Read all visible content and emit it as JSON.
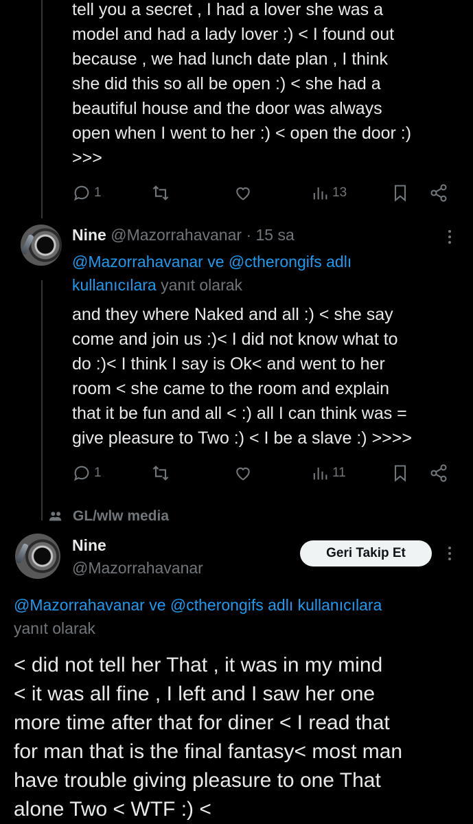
{
  "post1": {
    "lines": [
      "tell you a secret , I had a lover she was a",
      "model and had a lady lover :) < I found out",
      "because , we had lunch date plan , I think",
      "she did this so all be open :) < she had a",
      "beautiful house and the door was always",
      "open when I went to her :) <  open the door :)",
      ">>>"
    ],
    "actions": {
      "replies": "1",
      "views": "13"
    }
  },
  "post2": {
    "name": "Nine",
    "handle": "@Mazorrahavanar",
    "time": "· 15 sa",
    "reply_to_link": "@Mazorrahavanar ve @ctherongifs adlı",
    "reply_to_link2": "kullanıcılara",
    "reply_to_suffix": " yanıt olarak",
    "lines": [
      "and they where Naked and all :) < she say",
      "come and join us :)< I did not know what to",
      "do :)< I think I say is Ok< and went to her",
      "room < she came to the room and explain",
      "that it be fun and all < :) all I can think was =",
      "give pleasure to Two :) < I be a slave :) >>>>"
    ],
    "actions": {
      "replies": "1",
      "views": "11"
    }
  },
  "community": {
    "name": "GL/wlw media",
    "icon": "community-icon"
  },
  "post3": {
    "name": "Nine",
    "handle": "@Mazorrahavanar",
    "follow_label": "Geri Takip Et",
    "reply_to_link": "@Mazorrahavanar ve @ctherongifs adlı kullanıcılara",
    "reply_to_suffix": "yanıt olarak",
    "lines": [
      "< did not  tell her That  , it was in my mind",
      "<  it was all fine , I left  and I saw  her one",
      "more time after that  for diner < I read that",
      "for man that is the final fantasy< most man",
      "have trouble giving pleasure to one That",
      "alone Two < WTF :) <"
    ]
  },
  "colors": {
    "background": "#000000",
    "text": "#e7e9ea",
    "muted": "#71767b",
    "link": "#1d9bf0",
    "button": "#eff3f4"
  }
}
